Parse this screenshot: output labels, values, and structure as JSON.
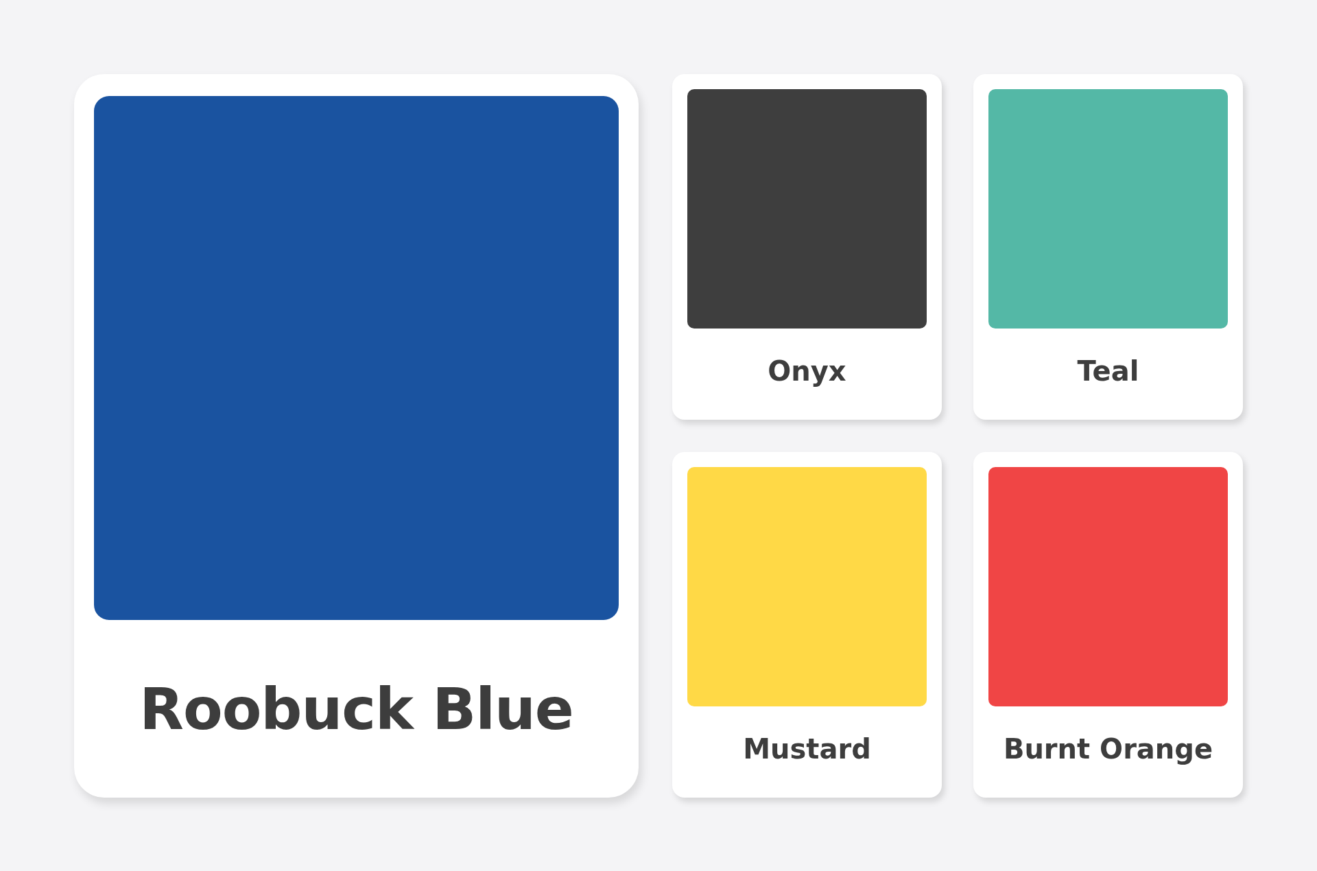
{
  "featured": {
    "name": "Roobuck Blue",
    "color": "#1a53a0"
  },
  "swatches": [
    {
      "name": "Onyx",
      "color": "#3e3e3e"
    },
    {
      "name": "Teal",
      "color": "#54b8a6"
    },
    {
      "name": "Mustard",
      "color": "#ffd946"
    },
    {
      "name": "Burnt Orange",
      "color": "#f04545"
    }
  ]
}
